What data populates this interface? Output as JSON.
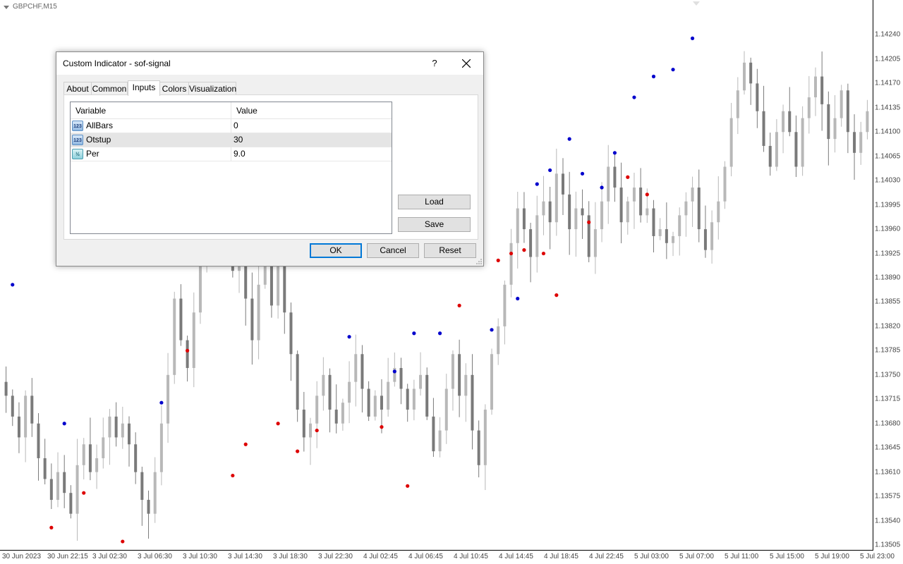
{
  "chart": {
    "symbol": "GBPCHF,M15",
    "price_labels": [
      "1.14240",
      "1.14205",
      "1.14170",
      "1.14135",
      "1.14100",
      "1.14065",
      "1.14030",
      "1.13995",
      "1.13960",
      "1.13925",
      "1.13890",
      "1.13855",
      "1.13820",
      "1.13785",
      "1.13750",
      "1.13715",
      "1.13680",
      "1.13645",
      "1.13610",
      "1.13575",
      "1.13540",
      "1.13505"
    ],
    "time_labels": [
      "30 Jun 2023",
      "30 Jun 22:15",
      "3 Jul 02:30",
      "3 Jul 06:30",
      "3 Jul 10:30",
      "3 Jul 14:30",
      "3 Jul 18:30",
      "3 Jul 22:30",
      "4 Jul 02:45",
      "4 Jul 06:45",
      "4 Jul 10:45",
      "4 Jul 14:45",
      "4 Jul 18:45",
      "4 Jul 22:45",
      "5 Jul 03:00",
      "5 Jul 07:00",
      "5 Jul 11:00",
      "5 Jul 15:00",
      "5 Jul 19:00",
      "5 Jul 23:00"
    ],
    "colors": {
      "bull": "#b8b8b8",
      "bear": "#7a7a7a",
      "buy_signal": "#0000cc",
      "sell_signal": "#dd0000"
    }
  },
  "chart_data": {
    "type": "candlestick",
    "price_range": [
      1.13505,
      1.14275
    ],
    "close_path": [
      1.1372,
      1.1369,
      1.1366,
      1.1372,
      1.1368,
      1.1363,
      1.136,
      1.1357,
      1.1361,
      1.1358,
      1.1355,
      1.1362,
      1.1365,
      1.1361,
      1.1363,
      1.1366,
      1.1369,
      1.1366,
      1.1368,
      1.1365,
      1.1361,
      1.1357,
      1.1355,
      1.1361,
      1.1368,
      1.1375,
      1.1386,
      1.138,
      1.1376,
      1.1384,
      1.1392,
      1.1396,
      1.1401,
      1.1405,
      1.1397,
      1.139,
      1.1395,
      1.1386,
      1.138,
      1.1388,
      1.1394,
      1.1385,
      1.1392,
      1.1384,
      1.1378,
      1.137,
      1.1366,
      1.1368,
      1.1372,
      1.1375,
      1.137,
      1.1368,
      1.1371,
      1.1374,
      1.1378,
      1.1373,
      1.1369,
      1.1372,
      1.137,
      1.1374,
      1.1376,
      1.1373,
      1.137,
      1.1373,
      1.1375,
      1.1369,
      1.1364,
      1.1367,
      1.1373,
      1.1378,
      1.1372,
      1.1375,
      1.1367,
      1.1362,
      1.137,
      1.1378,
      1.1382,
      1.1388,
      1.1394,
      1.1399,
      1.1396,
      1.1392,
      1.1398,
      1.14,
      1.1397,
      1.1404,
      1.1401,
      1.1396,
      1.1399,
      1.1398,
      1.1392,
      1.1396,
      1.14,
      1.1405,
      1.1402,
      1.1397,
      1.14,
      1.1402,
      1.1398,
      1.1399,
      1.1395,
      1.1396,
      1.1394,
      1.1395,
      1.1398,
      1.14,
      1.1402,
      1.1396,
      1.1393,
      1.1397,
      1.14,
      1.1405,
      1.1412,
      1.1416,
      1.142,
      1.1417,
      1.1413,
      1.1408,
      1.1405,
      1.141,
      1.1413,
      1.141,
      1.1405,
      1.1412,
      1.1415,
      1.1418,
      1.1414,
      1.1409,
      1.1412,
      1.1416,
      1.141,
      1.1407,
      1.141,
      1.1413
    ],
    "buy_signals": [
      [
        1,
        1.1388
      ],
      [
        9,
        1.1368
      ],
      [
        24,
        1.1371
      ],
      [
        53,
        1.13805
      ],
      [
        60,
        1.13755
      ],
      [
        63,
        1.1381
      ],
      [
        67,
        1.1381
      ],
      [
        75,
        1.13815
      ],
      [
        79,
        1.1386
      ],
      [
        82,
        1.14025
      ],
      [
        84,
        1.14045
      ],
      [
        87,
        1.1409
      ],
      [
        89,
        1.1404
      ],
      [
        92,
        1.1402
      ],
      [
        94,
        1.1407
      ],
      [
        97,
        1.1415
      ],
      [
        100,
        1.1418
      ],
      [
        103,
        1.1419
      ],
      [
        106,
        1.14235
      ]
    ],
    "sell_signals": [
      [
        7,
        1.1353
      ],
      [
        12,
        1.1358
      ],
      [
        18,
        1.1351
      ],
      [
        28,
        1.13785
      ],
      [
        35,
        1.13605
      ],
      [
        37,
        1.1365
      ],
      [
        42,
        1.1368
      ],
      [
        45,
        1.1364
      ],
      [
        48,
        1.1367
      ],
      [
        58,
        1.13675
      ],
      [
        62,
        1.1359
      ],
      [
        70,
        1.1385
      ],
      [
        73,
        1.13935
      ],
      [
        76,
        1.13915
      ],
      [
        78,
        1.13925
      ],
      [
        80,
        1.1393
      ],
      [
        83,
        1.13925
      ],
      [
        85,
        1.13865
      ],
      [
        90,
        1.1397
      ],
      [
        96,
        1.14035
      ],
      [
        99,
        1.1401
      ]
    ]
  },
  "dialog": {
    "title": "Custom Indicator - sof-signal",
    "help": "?",
    "tabs": [
      "About",
      "Common",
      "Inputs",
      "Colors",
      "Visualization"
    ],
    "active_tab": "Inputs",
    "grid": {
      "headers": [
        "Variable",
        "Value"
      ],
      "rows": [
        {
          "icon": "123",
          "variable": "AllBars",
          "value": "0"
        },
        {
          "icon": "123",
          "variable": "Otstup",
          "value": "30"
        },
        {
          "icon": "½",
          "variable": "Per",
          "value": "9.0"
        }
      ]
    },
    "buttons": {
      "load": "Load",
      "save": "Save",
      "ok": "OK",
      "cancel": "Cancel",
      "reset": "Reset"
    }
  }
}
